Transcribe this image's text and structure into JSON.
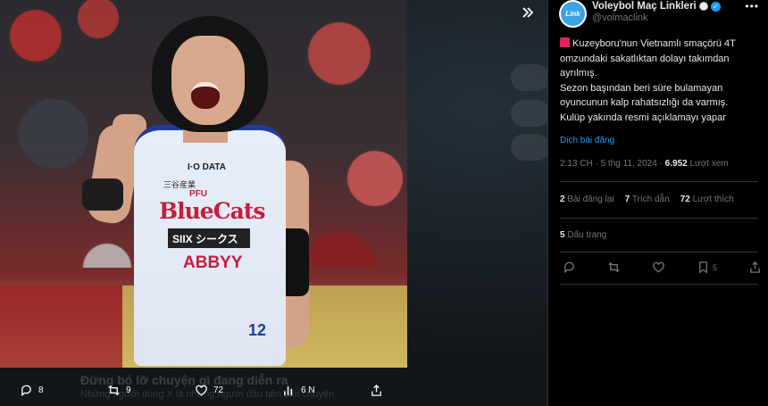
{
  "author": {
    "display_name": "Voleybol Maç Linkleri",
    "handle": "@volmaclink",
    "avatar_text": "Link"
  },
  "tweet": {
    "line1": "Kuzeyboru'nun Vietnamlı smaçörü 4T omzundaki sakatlıktan dolayı takımdan ayrılmış.",
    "line2": "Sezon başından beri süre bulamayan oyuncunun kalp rahatsızlığı da varmış.",
    "line3": " Kulüp yakında resmi açıklamayı yapar",
    "translate_label": "Dịch bài đăng",
    "time": "2:13 CH · 5 thg 11, 2024 · ",
    "views_count": "6.952",
    "views_label": " Lượt xem"
  },
  "stats": {
    "reposts_count": "2",
    "reposts_label": "Bài đăng lại",
    "quotes_count": "7",
    "quotes_label": "Trích dẫn",
    "likes_count": "72",
    "likes_label": "Lượt thích",
    "bookmarks_count": "5",
    "bookmarks_label": "Dấu trang"
  },
  "panel_actions": {
    "bookmark_count": "5"
  },
  "media_actions": {
    "replies": "8",
    "reposts": "9",
    "likes": "72",
    "views": "6 N"
  },
  "photo_text": {
    "sponsor1": "I·O DATA",
    "sponsor2": "三谷産業",
    "pfu": "PFU",
    "team": "BlueCats",
    "sponsor3": "SIIX シークス",
    "sponsor4": "ABBYY",
    "number": "12"
  },
  "background_text": {
    "headline": "Đừng bỏ lỡ chuyện gì đang diễn ra",
    "sub": "Những người dùng X là những người đầu tiên biết chuyện"
  },
  "colors": {
    "accent": "#1d9bf0",
    "text": "#e7e9ea",
    "muted": "#71767b",
    "divider": "#2f3336"
  }
}
